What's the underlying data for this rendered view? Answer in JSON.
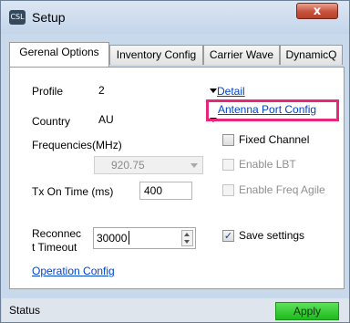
{
  "window": {
    "title": "Setup",
    "app_icon_text": "CSL",
    "close_label": "x"
  },
  "tabs": [
    {
      "label": "Gerenal Options",
      "active": true
    },
    {
      "label": "Inventory Config"
    },
    {
      "label": "Carrier Wave"
    },
    {
      "label": "DynamicQ"
    }
  ],
  "general": {
    "profile_label": "Profile",
    "profile_value": "2",
    "country_label": "Country",
    "country_value": "AU",
    "frequencies_label": "Frequencies(MHz)",
    "frequency_value": "920.75",
    "tx_on_time_label": "Tx On Time (ms)",
    "tx_on_time_value": "400",
    "reconnect_label_line1": "Reconnec",
    "reconnect_label_line2": "t Timeout",
    "reconnect_value": "30000",
    "detail_link": "Detail",
    "antenna_port_link": "Antenna Port Config",
    "operation_config_link": "Operation Config",
    "fixed_channel_label": "Fixed Channel",
    "fixed_channel_checked": false,
    "enable_lbt_label": "Enable LBT",
    "enable_lbt_checked": false,
    "enable_freq_agile_label": "Enable Freq Agile",
    "enable_freq_agile_checked": false,
    "save_settings_label": "Save settings",
    "save_settings_checked": true,
    "check_mark": "✓"
  },
  "statusbar": {
    "status_text": "Status",
    "apply_label": "Apply"
  },
  "colors": {
    "highlight": "#e8277a",
    "link": "#0044cc",
    "apply_green": "#22c322",
    "close_red": "#c7513b"
  }
}
